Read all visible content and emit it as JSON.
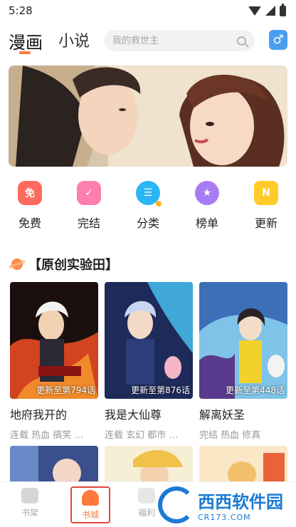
{
  "status_bar": {
    "time": "5:28"
  },
  "header": {
    "tabs": [
      {
        "label": "漫画",
        "active": true
      },
      {
        "label": "小说",
        "active": false
      }
    ],
    "search_placeholder": "我的救世主",
    "gender_icon": "♂"
  },
  "banner": {
    "icon": "comic-couple-illustration"
  },
  "nav": [
    {
      "label": "免费",
      "icon_text": "免",
      "icon": "free-icon"
    },
    {
      "label": "完结",
      "icon_text": "✓",
      "icon": "completed-icon"
    },
    {
      "label": "分类",
      "icon_text": "☰",
      "icon": "category-icon"
    },
    {
      "label": "榜单",
      "icon_text": "★",
      "icon": "ranking-icon"
    },
    {
      "label": "更新",
      "icon_text": "N",
      "icon": "update-icon"
    }
  ],
  "section": {
    "title": "【原创实验田】"
  },
  "comics": [
    {
      "title": "地府我开的",
      "tags": "连载 热血 搞笑 …",
      "badge": "更新至第794话"
    },
    {
      "title": "我是大仙尊",
      "tags": "连载 玄幻 都市 …",
      "badge": "更新至第876话"
    },
    {
      "title": "解离妖圣",
      "tags": "完结 热血 修真",
      "badge": "更新至第448话"
    }
  ],
  "bottom_nav": [
    {
      "label": "书架"
    },
    {
      "label": "书城"
    },
    {
      "label": "福利"
    }
  ],
  "watermark": {
    "main": "西西软件园",
    "sub": "CR173.COM"
  },
  "colors": {
    "accent": "#ff7a3c",
    "highlight_border": "#e2463b"
  }
}
